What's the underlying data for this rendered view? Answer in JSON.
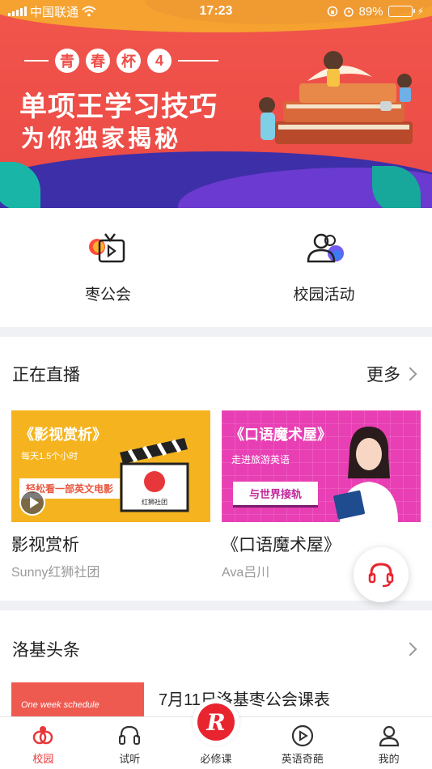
{
  "status_bar": {
    "carrier": "中国联通",
    "time": "17:23",
    "battery_percent": "89%",
    "battery_level": 0.89
  },
  "banner": {
    "cup_chars": [
      "青",
      "春",
      "杯",
      "4"
    ],
    "headline": "单项王学习技巧",
    "subheadline": "为你独家揭秘"
  },
  "quick_entries": [
    {
      "label": "枣公会",
      "icon": "tv-play-icon"
    },
    {
      "label": "校园活动",
      "icon": "user-group-icon"
    }
  ],
  "live_section": {
    "title": "正在直播",
    "more_label": "更多",
    "cards": [
      {
        "thumb_title": "《影视赏析》",
        "thumb_sub": "每天1.5个小时",
        "thumb_tag": "轻松看一部英文电影",
        "thumb_logo": "红狮社团",
        "title": "影视赏析",
        "author": "Sunny红狮社团"
      },
      {
        "thumb_title": "《口语魔术屋》",
        "thumb_sub": "走进旅游英语",
        "thumb_tag": "与世界接轨",
        "title": "《口语魔术屋》",
        "author": "Ava吕川"
      }
    ]
  },
  "news_section": {
    "title": "洛基头条",
    "items": [
      {
        "thumb_text": "One week schedule",
        "title": "7月11日洛基枣公会课表"
      }
    ]
  },
  "tabbar": {
    "tabs": [
      {
        "label": "校园",
        "icon": "campus-icon",
        "active": true
      },
      {
        "label": "试听",
        "icon": "headphones-icon",
        "active": false
      },
      {
        "label": "必修课",
        "icon": "r-logo-icon",
        "active": false
      },
      {
        "label": "英语奇葩",
        "icon": "play-circle-icon",
        "active": false
      },
      {
        "label": "我的",
        "icon": "profile-icon",
        "active": false
      }
    ],
    "center_letter": "R"
  },
  "colors": {
    "accent": "#e8373a",
    "banner_red": "#ee4f48",
    "card1_bg": "#f5b41f",
    "card2_bg": "#e83fb4",
    "separator": "#f0f1f4"
  }
}
